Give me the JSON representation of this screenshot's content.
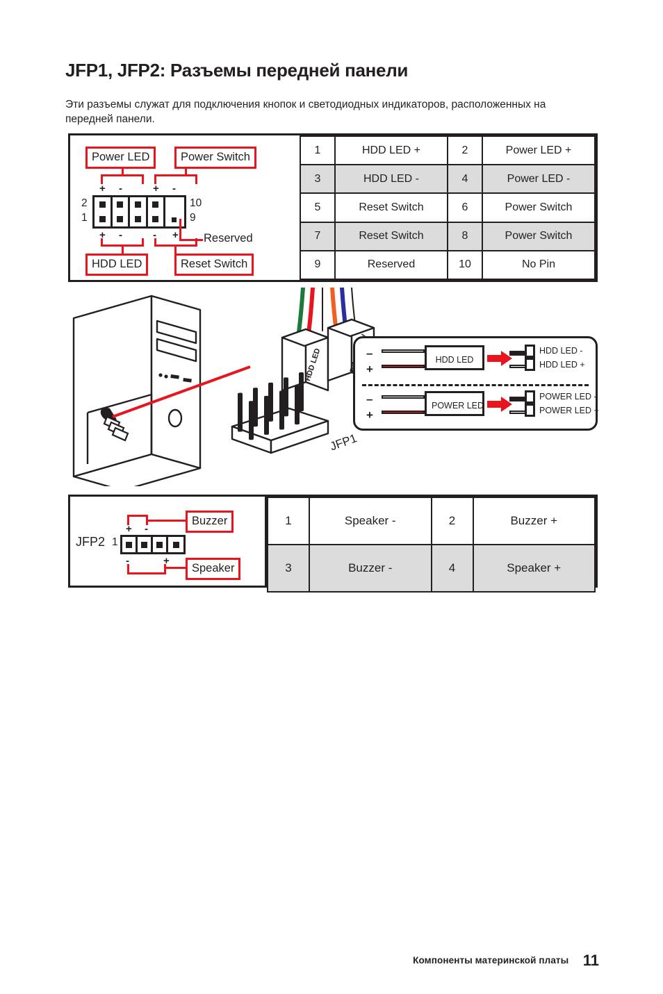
{
  "page": {
    "title": "JFP1, JFP2: Разъемы передней панели",
    "intro": "Эти разъемы служат для подключения кнопок и светодиодных индикаторов, расположенных на передней панели."
  },
  "jfp1": {
    "diagram": {
      "labels": {
        "power_led": "Power LED",
        "power_switch": "Power Switch",
        "hdd_led": "HDD LED",
        "reset_switch": "Reset Switch",
        "reserved": "Reserved"
      },
      "pin_numbers": {
        "top_left": "2",
        "bottom_left": "1",
        "top_right": "10",
        "bottom_right": "9"
      },
      "polarity_top": [
        "+",
        "-",
        "+",
        "-"
      ],
      "polarity_bottom": [
        "+",
        "-",
        "-",
        "+"
      ]
    },
    "rows": [
      {
        "shaded": false,
        "cells": [
          "1",
          "HDD LED +",
          "2",
          "Power LED +"
        ]
      },
      {
        "shaded": true,
        "cells": [
          "3",
          "HDD LED -",
          "4",
          "Power LED -"
        ]
      },
      {
        "shaded": false,
        "cells": [
          "5",
          "Reset Switch",
          "6",
          "Power Switch"
        ]
      },
      {
        "shaded": true,
        "cells": [
          "7",
          "Reset Switch",
          "8",
          "Power Switch"
        ]
      },
      {
        "shaded": false,
        "cells": [
          "9",
          "Reserved",
          "10",
          "No Pin"
        ]
      }
    ]
  },
  "illustration": {
    "connector_hdd_led": "HDD LED",
    "connector_reset_sw": "RESET SW",
    "header_label": "JFP1",
    "led_polarity": {
      "rows": [
        {
          "name": "HDD LED",
          "chip_label": "HDD LED",
          "minus_sign": "–",
          "plus_sign": "+",
          "pin_minus": "HDD LED -",
          "pin_plus": "HDD LED +"
        },
        {
          "name": "POWER LED",
          "chip_label": "POWER LED",
          "minus_sign": "–",
          "plus_sign": "+",
          "pin_minus": "POWER LED -",
          "pin_plus": "POWER LED +"
        }
      ]
    }
  },
  "jfp2": {
    "diagram": {
      "name": "JFP2",
      "labels": {
        "buzzer": "Buzzer",
        "speaker": "Speaker"
      },
      "pin_number_first": "1",
      "polarity_top": [
        "+",
        "-"
      ],
      "polarity_bottom": [
        "-",
        "+"
      ]
    },
    "rows": [
      {
        "shaded": false,
        "cells": [
          "1",
          "Speaker -",
          "2",
          "Buzzer +"
        ]
      },
      {
        "shaded": true,
        "cells": [
          "3",
          "Buzzer -",
          "4",
          "Speaker +"
        ]
      }
    ]
  },
  "footer": {
    "label": "Компоненты материнской платы",
    "page_number": "11"
  },
  "colors": {
    "accent_red": "#e8141e",
    "ink": "#231f20",
    "row_shade": "#dcdcdc"
  }
}
